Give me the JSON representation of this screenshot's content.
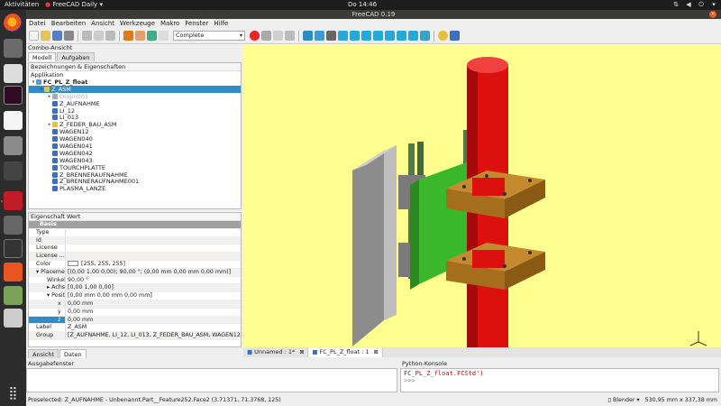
{
  "topbar": {
    "activities": "Aktivitäten",
    "app_name": "FreeCAD Daily",
    "clock": "Do 14:46"
  },
  "window": {
    "title": "FreeCAD 0.19"
  },
  "menu": [
    "Datei",
    "Bearbeiten",
    "Ansicht",
    "Werkzeuge",
    "Makro",
    "Fenster",
    "Hilfe"
  ],
  "toolbar": {
    "workbench": "Complete"
  },
  "combo": {
    "title": "Combo-Ansicht",
    "tabs": [
      "Modell",
      "Aufgaben"
    ],
    "tree_header": "Bezeichnungen & Eigenschaften",
    "tree_section": "Applikation",
    "items": [
      {
        "label": "FC_PL_Z_float",
        "level": 0,
        "exp": "▾",
        "color": "#5a9bd5",
        "bold": true
      },
      {
        "label": "Z_ASM",
        "level": 1,
        "exp": "▾",
        "color": "#e8c040",
        "selected": true
      },
      {
        "label": "Origin001",
        "level": 2,
        "exp": "▸",
        "color": "#aaaaaa",
        "faded": true
      },
      {
        "label": "Z_AUFNAHME",
        "level": 2,
        "exp": "",
        "color": "#3b6fc0"
      },
      {
        "label": "LI_12",
        "level": 2,
        "exp": "",
        "color": "#3b6fc0"
      },
      {
        "label": "LI_013",
        "level": 2,
        "exp": "",
        "color": "#3b6fc0"
      },
      {
        "label": "Z_FEDER_BAU_ASM",
        "level": 2,
        "exp": "▸",
        "color": "#e8c040"
      },
      {
        "label": "WAGEN12",
        "level": 2,
        "exp": "",
        "color": "#3b6fc0"
      },
      {
        "label": "WAGEN040",
        "level": 2,
        "exp": "",
        "color": "#3b6fc0"
      },
      {
        "label": "WAGEN041",
        "level": 2,
        "exp": "",
        "color": "#3b6fc0"
      },
      {
        "label": "WAGEN042",
        "level": 2,
        "exp": "",
        "color": "#3b6fc0"
      },
      {
        "label": "WAGEN043",
        "level": 2,
        "exp": "",
        "color": "#3b6fc0"
      },
      {
        "label": "TOURCHPLATTE",
        "level": 2,
        "exp": "",
        "color": "#3b6fc0"
      },
      {
        "label": "Z_BRENNERAUFNAHME",
        "level": 2,
        "exp": "",
        "color": "#3b6fc0"
      },
      {
        "label": "Z_BRENNERAUFNAHME001",
        "level": 2,
        "exp": "",
        "color": "#3b6fc0"
      },
      {
        "label": "PLASMA_LANZE",
        "level": 2,
        "exp": "",
        "color": "#3b6fc0"
      }
    ]
  },
  "props": {
    "header": [
      "Eigenschaft",
      "Wert"
    ],
    "rows": [
      {
        "k": "Basis",
        "v": "",
        "type": "group"
      },
      {
        "k": "Type",
        "v": ""
      },
      {
        "k": "Id",
        "v": ""
      },
      {
        "k": "License",
        "v": ""
      },
      {
        "k": "License ...",
        "v": ""
      },
      {
        "k": "Color",
        "v": "[255, 255, 255]",
        "swatch": true
      },
      {
        "k": "▾ Placement",
        "v": "[(0,00 1,00 0,00); 90,00 °; (0,00 mm  0,00 mm  0,00 mm)]"
      },
      {
        "k": "Winkel",
        "v": "90,00 °",
        "indent": 1
      },
      {
        "k": "▸ Achse",
        "v": "[0,00 1,00 0,00]",
        "indent": 1
      },
      {
        "k": "▾ Positi...",
        "v": "[0,00 mm  0,00 mm  0,00 mm]",
        "indent": 1
      },
      {
        "k": "x",
        "v": "0,00 mm",
        "indent": 2
      },
      {
        "k": "y",
        "v": "0,00 mm",
        "indent": 2
      },
      {
        "k": "z",
        "v": "0,00 mm",
        "indent": 2,
        "selected": true
      },
      {
        "k": "Label",
        "v": "Z_ASM"
      },
      {
        "k": "Group",
        "v": "[Z_AUFNAHME, LI_12, LI_013, Z_FEDER_BAU_ASM, WAGEN12, W..."
      }
    ],
    "bottom_tabs": [
      "Ansicht",
      "Daten"
    ]
  },
  "doc_tabs": [
    {
      "label": "Unnamed : 1*",
      "active": false
    },
    {
      "label": "FC_PL_Z_float : 1",
      "active": true
    }
  ],
  "report": {
    "title": "Ausgabefenster"
  },
  "python": {
    "title": "Python-Konsole",
    "line1": "FC_PL_Z_float.FCStd')",
    "prompt": ">>>"
  },
  "status": {
    "left": "Preselected: Z_AUFNAHME - Unbenannt.Part__Feature252.Face2 (3.71371, 71.3768, 125)",
    "nav": "Blender",
    "dims": "530,95 mm x 337,38 mm"
  },
  "colors": {
    "view_bg": "#ffff90",
    "rod": "#dd1010",
    "plate_grey": "#bcbcbc",
    "plate_green": "#39b82b",
    "flange": "#b87a22",
    "selection": "#308cc6"
  }
}
